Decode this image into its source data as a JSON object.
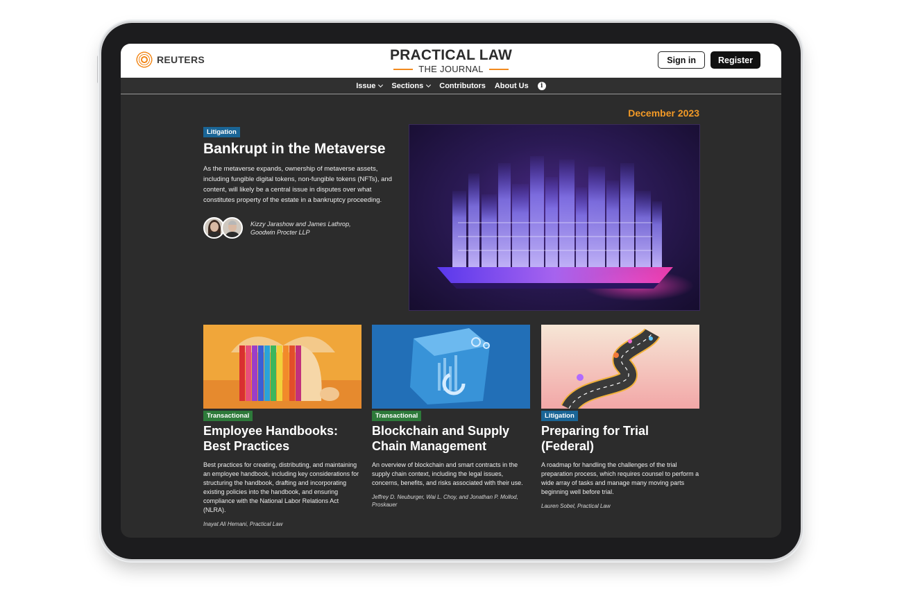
{
  "header": {
    "publisher": "REUTERS",
    "brand_title": "PRACTICAL LAW",
    "brand_subtitle": "THE JOURNAL",
    "sign_in_label": "Sign in",
    "register_label": "Register"
  },
  "nav": {
    "items": [
      {
        "label": "Issue",
        "dropdown": true
      },
      {
        "label": "Sections",
        "dropdown": true
      },
      {
        "label": "Contributors",
        "dropdown": false
      },
      {
        "label": "About Us",
        "dropdown": false
      }
    ],
    "info_icon": "info-icon"
  },
  "issue": {
    "date": "December 2023"
  },
  "hero": {
    "badge": "Litigation",
    "title": "Bankrupt in the Metaverse",
    "description": "As the metaverse expands, ownership of metaverse assets, including fungible digital tokens, non-fungible tokens (NFTs), and content, will likely be a central issue in disputes over what constitutes property of the estate in a bankruptcy proceeding.",
    "authors_line1": "Kizzy Jarashow and James Lathrop,",
    "authors_line2": "Goodwin Procter LLP"
  },
  "cards": [
    {
      "badge": "Transactional",
      "badge_color": "#2d7a3a",
      "title": "Employee Handbooks: Best Practices",
      "description": "Best practices for creating, distributing, and maintaining an employee handbook, including key considerations for structuring the handbook, drafting and incorporating existing policies into the handbook, and ensuring compliance with the National Labor Relations Act (NLRA).",
      "author": "Inayat Ali Hemani, Practical Law"
    },
    {
      "badge": "Transactional",
      "badge_color": "#2d7a3a",
      "title": "Blockchain and Supply Chain Management",
      "description": "An overview of blockchain and smart contracts in the supply chain context, including the legal issues, concerns, benefits, and risks associated with their use.",
      "author": "Jeffrey D. Neuburger, Wai L. Choy, and Jonathan P. Mollod, Proskauer"
    },
    {
      "badge": "Litigation",
      "badge_color": "#1a6596",
      "title": "Preparing for Trial (Federal)",
      "description": "A roadmap for handling the challenges of the trial preparation process, which requires counsel to perform a wide array of tasks and manage many moving parts beginning well before trial.",
      "author": "Lauren Sobel, Practical Law"
    }
  ],
  "colors": {
    "accent_orange": "#f39a26",
    "litigation_badge": "#1a6596",
    "transactional_badge": "#2d7a3a",
    "page_background": "#2c2c2c"
  }
}
